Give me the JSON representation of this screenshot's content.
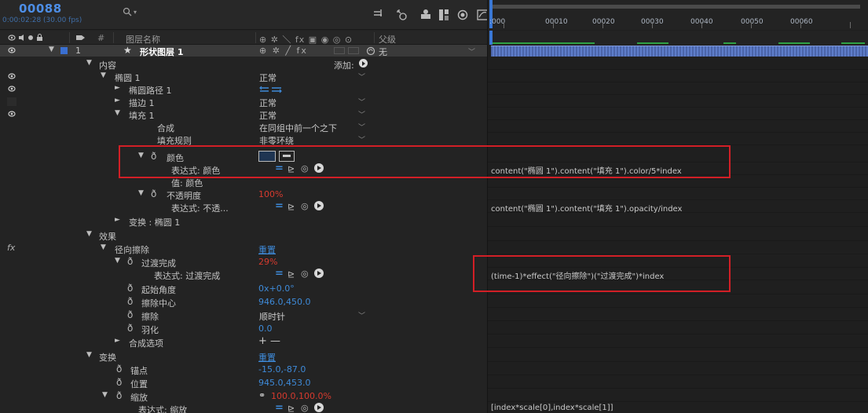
{
  "header": {
    "timecode": "00088",
    "timecode_sub": "0:00:02:28 (30.00 fps)",
    "search_placeholder": ""
  },
  "columns": {
    "layer_name": "图层名称",
    "parent": "父级",
    "switches_header": "⊕ ✲ ＼ fx ▣ ◉ ◎ ⊙"
  },
  "layer": {
    "number": "1",
    "name": "形状图层 1",
    "switches": "⊕ ✲ ╱ fx",
    "parent_value": "无"
  },
  "rows": {
    "contents": "内容",
    "add_label": "添加:",
    "ellipse1": "椭圆 1",
    "ellipse1_mode": "正常",
    "ellipse_path": "椭圆路径 1",
    "stroke": "描边 1",
    "stroke_mode": "正常",
    "fill": "填充 1",
    "fill_mode": "正常",
    "composite": "合成",
    "composite_value": "在同组中前一个之下",
    "fill_rule": "填充规则",
    "fill_rule_value": "非零环绕",
    "color": "颜色",
    "color_expr_label": "表达式: 颜色",
    "value_color": "值: 颜色",
    "opacity": "不透明度",
    "opacity_value": "100%",
    "opacity_expr_label": "表达式: 不透...",
    "transform_ellipse": "变换 : 椭圆 1",
    "effects": "效果",
    "radial_wipe": "径向擦除",
    "reset_label": "重置",
    "transition_completion": "过渡完成",
    "transition_value": "29%",
    "transition_expr_label": "表达式: 过渡完成",
    "start_angle": "起始角度",
    "start_angle_value": "0x+0.0°",
    "wipe_center": "擦除中心",
    "wipe_center_value": "946.0,450.0",
    "wipe": "擦除",
    "wipe_value": "顺时针",
    "feather": "羽化",
    "feather_value": "0.0",
    "compositing_options": "合成选项",
    "compositing_options_value": "+ —",
    "transform": "变换",
    "transform_reset": "重置",
    "anchor": "锚点",
    "anchor_value": "-15.0,-87.0",
    "position": "位置",
    "position_value": "945.0,453.0",
    "scale": "缩放",
    "scale_value": "100.0,100.0%",
    "scale_expr_label": "表达式: 缩放"
  },
  "timeline": {
    "ruler_labels": [
      ":000",
      "00010",
      "00020",
      "00030",
      "00040",
      "00050",
      "00060"
    ]
  },
  "expressions": {
    "color": "content(\"椭圆 1\").content(\"填充 1\").color/5*index",
    "opacity": "content(\"椭圆 1\").content(\"填充 1\").opacity/index",
    "transition": "(time-1)*effect(\"径向擦除\")(\"过渡完成\")*index",
    "scale": "[index*scale[0],index*scale[1]]"
  },
  "colors": {
    "accent_blue": "#3e8ad8",
    "value_red": "#d63a2e",
    "highlight_box": "#d21f26",
    "layer_bar": "#5a79c7"
  }
}
